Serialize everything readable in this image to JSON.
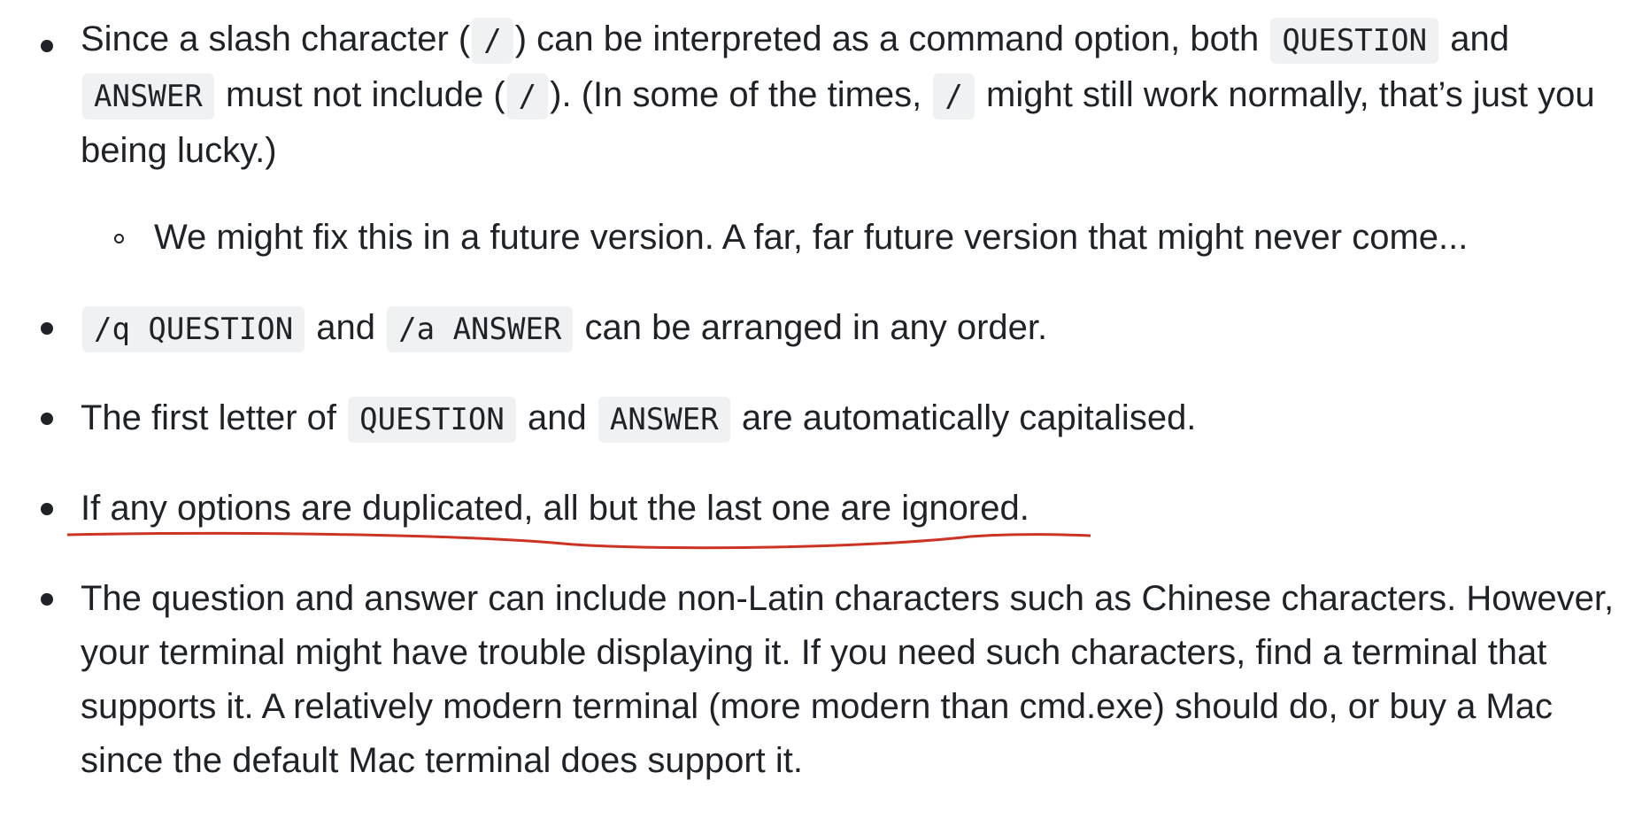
{
  "items": [
    {
      "t1": "Since a slash character (",
      "c1": "/",
      "t2": ") can be interpreted as a command option, both",
      "c2": "QUESTION",
      "t3": "and",
      "c3": "ANSWER",
      "t4": "must not include (",
      "c4": "/",
      "t5": "). (In some of the times,",
      "c5": "/",
      "t6": "might still work normally, that’s just you being lucky.)"
    },
    {
      "t1": "We might fix this in a future version. A far, far future version that might never come..."
    },
    {
      "c1": "/q QUESTION",
      "t1": "and",
      "c2": "/a ANSWER",
      "t2": "can be arranged in any order."
    },
    {
      "t1": "The first letter of",
      "c1": "QUESTION",
      "t2": "and",
      "c2": "ANSWER",
      "t3": "are automatically capitalised."
    },
    {
      "t1": "If any options are duplicated, all but the last one are ignored."
    },
    {
      "t1": "The question and answer can include non-Latin characters such as Chinese characters. However, your terminal might have trouble displaying it. If you need such characters, find a terminal that supports it. A relatively modern terminal (more modern than cmd.exe) should do, or buy a Mac since the default Mac terminal does support it."
    }
  ],
  "colors": {
    "text": "#1f2328",
    "code_bg": "#eff1f3",
    "annotation": "#cc3322"
  }
}
